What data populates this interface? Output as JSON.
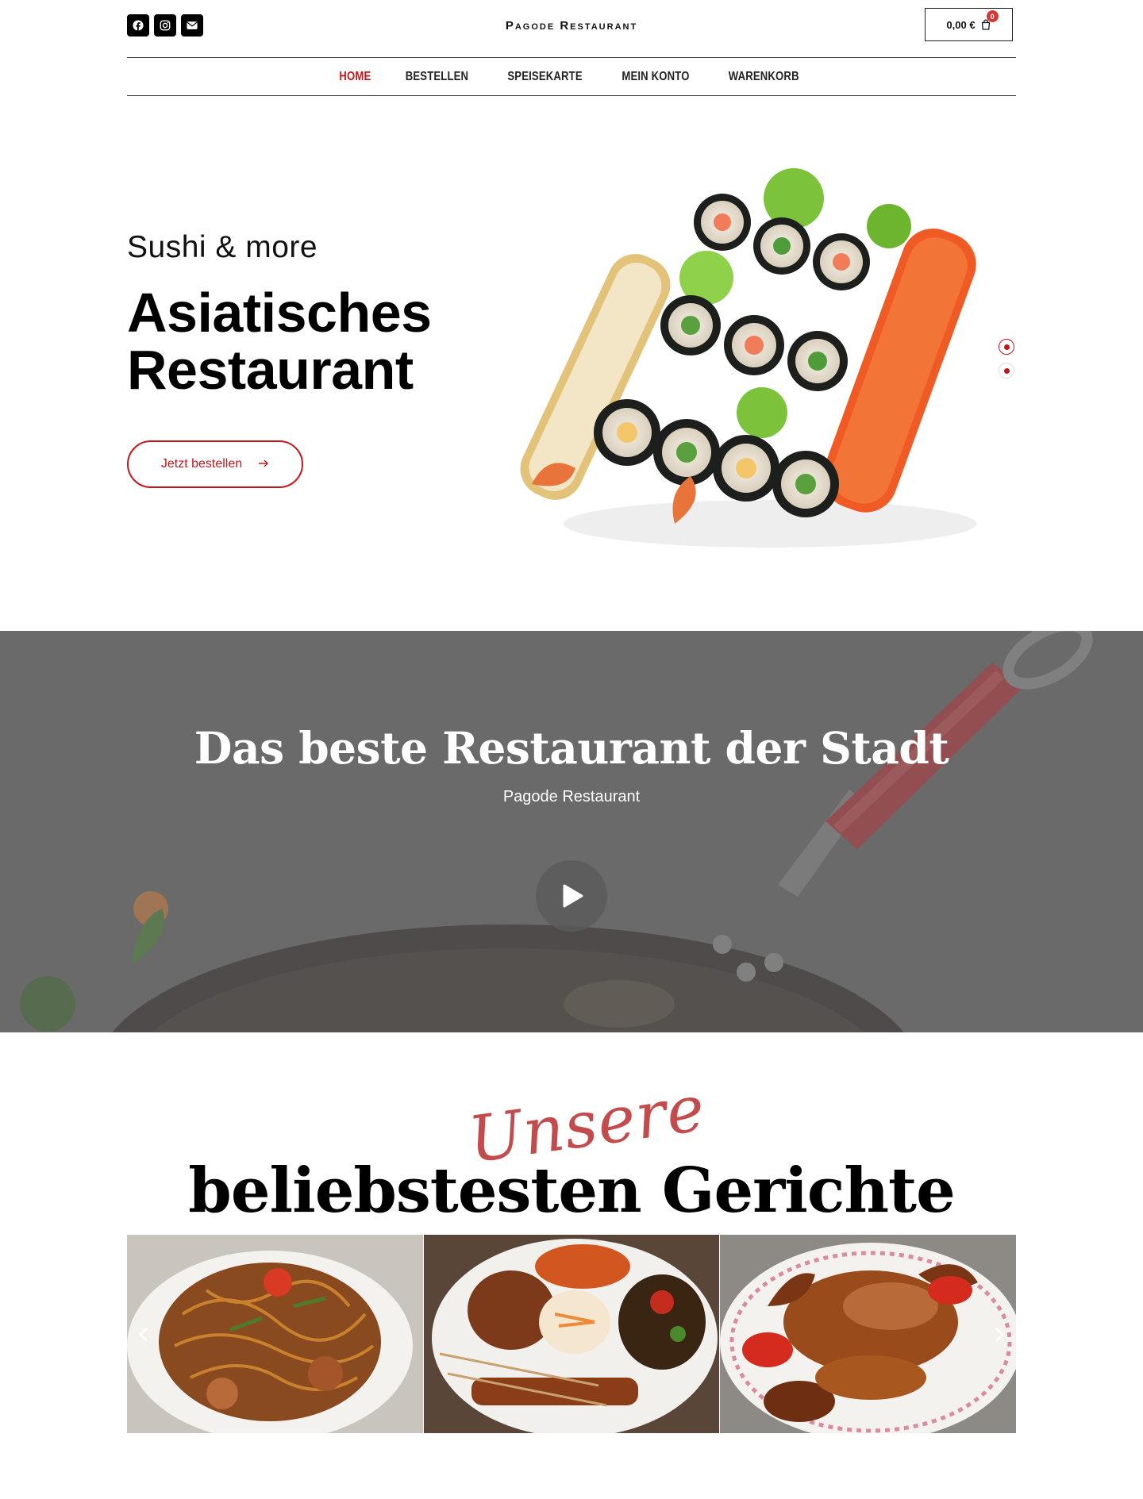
{
  "header": {
    "brand": "Pagode Restaurant",
    "cart_total": "0,00 €",
    "cart_count": "0",
    "social": [
      "facebook-icon",
      "instagram-icon",
      "envelope-icon"
    ]
  },
  "nav": {
    "items": [
      "HOME",
      "BESTELLEN",
      "SPEISEKARTE",
      "MEIN KONTO",
      "WARENKORB"
    ],
    "active": "HOME"
  },
  "hero": {
    "subtitle": "Sushi & more",
    "title_line1": "Asiatisches",
    "title_line2": "Restaurant",
    "button_label": "Jetzt bestellen",
    "slide_count": 2,
    "active_slide": 1
  },
  "video": {
    "title": "Das beste Restaurant der Stadt",
    "subtitle": "Pagode Restaurant",
    "icon": "play-icon"
  },
  "dishes": {
    "script_label": "Unsere",
    "title": "beliebstesten Gerichte",
    "images": [
      "noodles-dish",
      "mixed-plate-dish",
      "roast-duck-dish"
    ]
  },
  "colors": {
    "accent": "#c3161c",
    "band": "#686868",
    "script": "#c44b4b"
  }
}
